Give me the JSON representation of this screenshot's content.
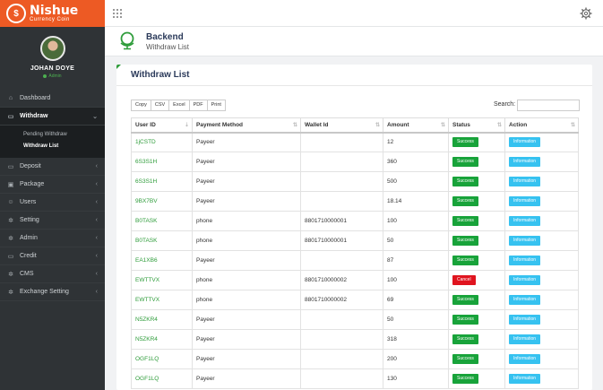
{
  "brand": {
    "name": "Nishue",
    "tagline": "Currency Coin",
    "color": "#ed5a24"
  },
  "user": {
    "name": "JOHAN DOYE",
    "role": "Admin"
  },
  "nav": [
    {
      "label": "Dashboard",
      "icon": "home-icon",
      "chevron": false
    },
    {
      "label": "Withdraw",
      "icon": "card-icon",
      "chevron": true,
      "active": true,
      "children": [
        {
          "label": "Pending Withdraw"
        },
        {
          "label": "Withdraw List",
          "active": true
        }
      ]
    },
    {
      "label": "Deposit",
      "icon": "card-icon",
      "chevron": true
    },
    {
      "label": "Package",
      "icon": "box-icon",
      "chevron": true
    },
    {
      "label": "Users",
      "icon": "users-icon",
      "chevron": true
    },
    {
      "label": "Setting",
      "icon": "gear-icon",
      "chevron": true
    },
    {
      "label": "Admin",
      "icon": "gear-icon",
      "chevron": true
    },
    {
      "label": "Credit",
      "icon": "card-icon",
      "chevron": true
    },
    {
      "label": "CMS",
      "icon": "gear-icon",
      "chevron": true
    },
    {
      "label": "Exchange Setting",
      "icon": "gear-icon",
      "chevron": true
    }
  ],
  "header": {
    "title": "Backend",
    "subtitle": "Withdraw List"
  },
  "card": {
    "title": "Withdraw List",
    "buttons": [
      "Copy",
      "CSV",
      "Excel",
      "PDF",
      "Print"
    ],
    "search_label": "Search:"
  },
  "table": {
    "columns": [
      "User ID",
      "Payment Method",
      "Wallet Id",
      "Amount",
      "Status",
      "Action"
    ],
    "rows": [
      {
        "user_id": "1jCSTD",
        "method": "Payeer",
        "wallet": "",
        "amount": "12",
        "status": "Success",
        "action": "Information"
      },
      {
        "user_id": "6S3S1H",
        "method": "Payeer",
        "wallet": "",
        "amount": "360",
        "status": "Success",
        "action": "Information"
      },
      {
        "user_id": "6S3S1H",
        "method": "Payeer",
        "wallet": "",
        "amount": "500",
        "status": "Success",
        "action": "Information"
      },
      {
        "user_id": "9BX7BV",
        "method": "Payeer",
        "wallet": "",
        "amount": "18.14",
        "status": "Success",
        "action": "Information"
      },
      {
        "user_id": "B0TASK",
        "method": "phone",
        "wallet": "8801710000001",
        "amount": "100",
        "status": "Success",
        "action": "Information"
      },
      {
        "user_id": "B0TASK",
        "method": "phone",
        "wallet": "8801710000001",
        "amount": "50",
        "status": "Success",
        "action": "Information"
      },
      {
        "user_id": "EA1XB6",
        "method": "Payeer",
        "wallet": "",
        "amount": "87",
        "status": "Success",
        "action": "Information"
      },
      {
        "user_id": "EWTTVX",
        "method": "phone",
        "wallet": "8801710000002",
        "amount": "100",
        "status": "Cancel",
        "action": "Information"
      },
      {
        "user_id": "EWTTVX",
        "method": "phone",
        "wallet": "8801710000002",
        "amount": "69",
        "status": "Success",
        "action": "Information"
      },
      {
        "user_id": "N5ZKR4",
        "method": "Payeer",
        "wallet": "",
        "amount": "50",
        "status": "Success",
        "action": "Information"
      },
      {
        "user_id": "N5ZKR4",
        "method": "Payeer",
        "wallet": "",
        "amount": "318",
        "status": "Success",
        "action": "Information"
      },
      {
        "user_id": "OGF1LQ",
        "method": "Payeer",
        "wallet": "",
        "amount": "200",
        "status": "Success",
        "action": "Information"
      },
      {
        "user_id": "OGF1LQ",
        "method": "Payeer",
        "wallet": "",
        "amount": "130",
        "status": "Success",
        "action": "Information"
      }
    ]
  },
  "colors": {
    "sidebar": "#2f3336",
    "success": "#18a33a",
    "cancel": "#e0141f",
    "info": "#36c2f0",
    "link": "#2e9c3a"
  }
}
